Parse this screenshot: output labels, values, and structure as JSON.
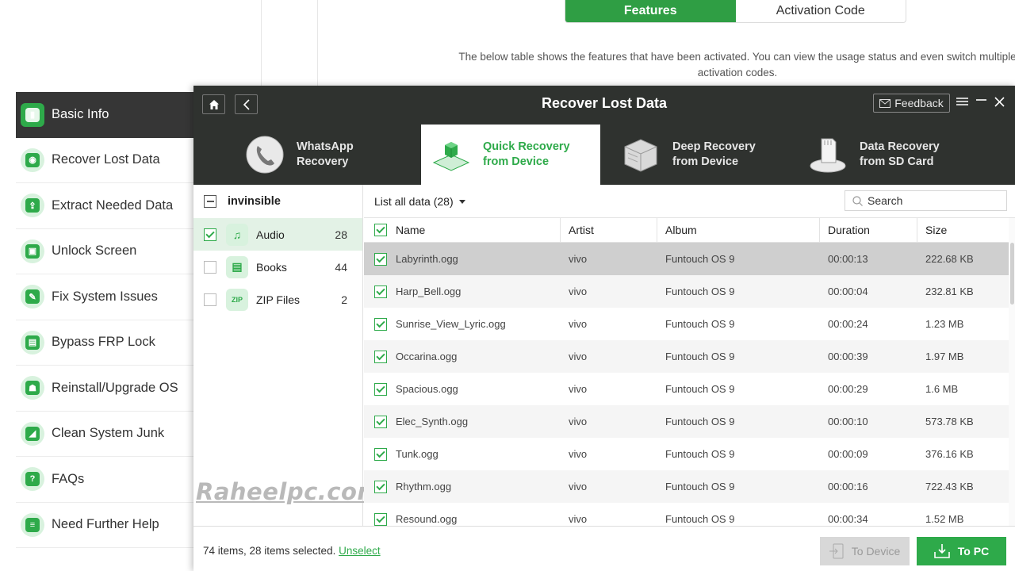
{
  "background": {
    "tabs": {
      "features": "Features",
      "activation_code": "Activation Code"
    },
    "description": "The below table shows the features that have been activated. You can view the usage status and even switch multiple activation codes.",
    "sidebar": [
      {
        "label": "Basic Info",
        "icon": "phone-icon",
        "active": true
      },
      {
        "label": "Recover Lost Data",
        "icon": "recover-icon"
      },
      {
        "label": "Extract Needed Data",
        "icon": "extract-icon"
      },
      {
        "label": "Unlock Screen",
        "icon": "lock-icon"
      },
      {
        "label": "Fix System Issues",
        "icon": "wrench-icon"
      },
      {
        "label": "Bypass FRP Lock",
        "icon": "unlock-icon"
      },
      {
        "label": "Reinstall/Upgrade OS",
        "icon": "android-icon"
      },
      {
        "label": "Clean System Junk",
        "icon": "broom-icon"
      },
      {
        "label": "FAQs",
        "icon": "question-icon"
      },
      {
        "label": "Need Further Help",
        "icon": "help-doc-icon"
      }
    ]
  },
  "window": {
    "title": "Recover Lost Data",
    "feedback": "Feedback",
    "modes": [
      {
        "line1": "WhatsApp",
        "line2": "Recovery",
        "icon": "phone-handset-icon"
      },
      {
        "line1": "Quick Recovery",
        "line2": "from Device",
        "icon": "quick-recovery-icon",
        "active": true
      },
      {
        "line1": "Deep Recovery",
        "line2": "from Device",
        "icon": "deep-recovery-icon"
      },
      {
        "line1": "Data Recovery",
        "line2": "from SD Card",
        "icon": "sd-card-icon"
      }
    ],
    "device": "invinsible",
    "categories": [
      {
        "name": "Audio",
        "count": "28",
        "checked": true,
        "icon": "music-note-icon"
      },
      {
        "name": "Books",
        "count": "44",
        "checked": false,
        "icon": "book-icon"
      },
      {
        "name": "ZIP Files",
        "count": "2",
        "checked": false,
        "icon": "zip-icon"
      }
    ],
    "list_filter": "List all data (28)",
    "search_placeholder": "Search",
    "columns": [
      "Name",
      "Artist",
      "Album",
      "Duration",
      "Size"
    ],
    "rows": [
      [
        "Labyrinth.ogg",
        "vivo",
        "Funtouch OS 9",
        "00:00:13",
        "222.68 KB"
      ],
      [
        "Harp_Bell.ogg",
        "vivo",
        "Funtouch OS 9",
        "00:00:04",
        "232.81 KB"
      ],
      [
        "Sunrise_View_Lyric.ogg",
        "vivo",
        "Funtouch OS 9",
        "00:00:24",
        "1.23 MB"
      ],
      [
        "Occarina.ogg",
        "vivo",
        "Funtouch OS 9",
        "00:00:39",
        "1.97 MB"
      ],
      [
        "Spacious.ogg",
        "vivo",
        "Funtouch OS 9",
        "00:00:29",
        "1.6 MB"
      ],
      [
        "Elec_Synth.ogg",
        "vivo",
        "Funtouch OS 9",
        "00:00:10",
        "573.78 KB"
      ],
      [
        "Tunk.ogg",
        "vivo",
        "Funtouch OS 9",
        "00:00:09",
        "376.16 KB"
      ],
      [
        "Rhythm.ogg",
        "vivo",
        "Funtouch OS 9",
        "00:00:16",
        "722.43 KB"
      ],
      [
        "Resound.ogg",
        "vivo",
        "Funtouch OS 9",
        "00:00:34",
        "1.52 MB"
      ]
    ],
    "status": "74 items, 28 items selected.",
    "unselect": "Unselect",
    "to_device": "To Device",
    "to_pc": "To PC"
  },
  "watermark": "Raheelpc.com",
  "colors": {
    "accent": "#2eaa4a",
    "titlebar": "#2f322f",
    "sidebar_active": "#363636"
  }
}
